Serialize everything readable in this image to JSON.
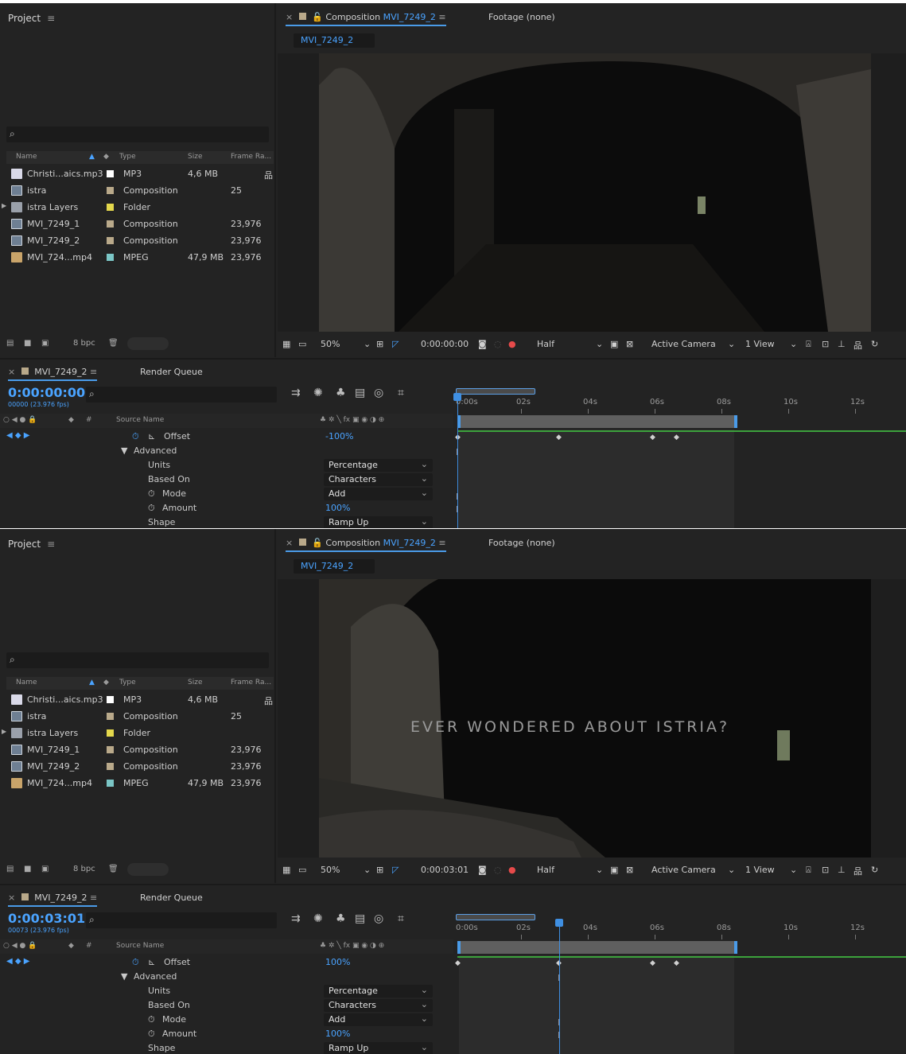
{
  "screens": [
    {
      "project": {
        "title": "Project",
        "menu_icon": "≡",
        "search_icon": "⌕",
        "columns": {
          "name": "Name",
          "type": "Type",
          "size": "Size",
          "frame_rate": "Frame Ra..."
        },
        "items": [
          {
            "name": "Christi...aics.mp3",
            "type": "MP3",
            "size": "4,6 MB",
            "frame_rate": "",
            "icon": "audio-file-icon",
            "color": "#ffffff"
          },
          {
            "name": "istra",
            "type": "Composition",
            "size": "",
            "frame_rate": "25",
            "icon": "composition-icon",
            "color": "#b9a98a"
          },
          {
            "name": "istra Layers",
            "type": "Folder",
            "size": "",
            "frame_rate": "",
            "icon": "folder-icon",
            "color": "#e4d84c"
          },
          {
            "name": "MVI_7249_1",
            "type": "Composition",
            "size": "",
            "frame_rate": "23,976",
            "icon": "composition-icon",
            "color": "#b9a98a"
          },
          {
            "name": "MVI_7249_2",
            "type": "Composition",
            "size": "",
            "frame_rate": "23,976",
            "icon": "composition-icon",
            "color": "#b9a98a"
          },
          {
            "name": "MVI_724...mp4",
            "type": "MPEG",
            "size": "47,9 MB",
            "frame_rate": "23,976",
            "icon": "video-file-icon",
            "color": "#7bc6c6"
          }
        ],
        "bit_depth": "8 bpc"
      },
      "composition": {
        "tab_prefix": "Composition",
        "tab_name": "MVI_7249_2",
        "footage_tab": "Footage (none)",
        "subtab": "MVI_7249_2",
        "overlay_text": "",
        "toolbar": {
          "zoom": "50%",
          "timecode": "0:00:00:00",
          "resolution": "Half",
          "camera": "Active Camera",
          "views": "1 View"
        }
      },
      "timeline": {
        "tab": "MVI_7249_2",
        "render_queue": "Render Queue",
        "timecode": "0:00:00:00",
        "frame_info": "00000 (23.976 fps)",
        "source_name_header": "Source Name",
        "ruler": [
          "0:00s",
          "02s",
          "04s",
          "06s",
          "08s",
          "10s",
          "12s"
        ],
        "current_time_seconds": 0.0,
        "properties": {
          "offset_label": "Offset",
          "offset_value": "-100%",
          "advanced_label": "Advanced",
          "units_label": "Units",
          "units_value": "Percentage",
          "based_on_label": "Based On",
          "based_on_value": "Characters",
          "mode_label": "Mode",
          "mode_value": "Add",
          "amount_label": "Amount",
          "amount_value": "100%",
          "shape_label": "Shape",
          "shape_value": "Ramp Up"
        }
      }
    },
    {
      "project": {
        "title": "Project",
        "menu_icon": "≡",
        "search_icon": "⌕",
        "columns": {
          "name": "Name",
          "type": "Type",
          "size": "Size",
          "frame_rate": "Frame Ra..."
        },
        "items": [
          {
            "name": "Christi...aics.mp3",
            "type": "MP3",
            "size": "4,6 MB",
            "frame_rate": "",
            "icon": "audio-file-icon",
            "color": "#ffffff"
          },
          {
            "name": "istra",
            "type": "Composition",
            "size": "",
            "frame_rate": "25",
            "icon": "composition-icon",
            "color": "#b9a98a"
          },
          {
            "name": "istra Layers",
            "type": "Folder",
            "size": "",
            "frame_rate": "",
            "icon": "folder-icon",
            "color": "#e4d84c"
          },
          {
            "name": "MVI_7249_1",
            "type": "Composition",
            "size": "",
            "frame_rate": "23,976",
            "icon": "composition-icon",
            "color": "#b9a98a"
          },
          {
            "name": "MVI_7249_2",
            "type": "Composition",
            "size": "",
            "frame_rate": "23,976",
            "icon": "composition-icon",
            "color": "#b9a98a"
          },
          {
            "name": "MVI_724...mp4",
            "type": "MPEG",
            "size": "47,9 MB",
            "frame_rate": "23,976",
            "icon": "video-file-icon",
            "color": "#7bc6c6"
          }
        ],
        "bit_depth": "8 bpc"
      },
      "composition": {
        "tab_prefix": "Composition",
        "tab_name": "MVI_7249_2",
        "footage_tab": "Footage (none)",
        "subtab": "MVI_7249_2",
        "overlay_text": "EVER WONDERED ABOUT ISTRIA?",
        "toolbar": {
          "zoom": "50%",
          "timecode": "0:00:03:01",
          "resolution": "Half",
          "camera": "Active Camera",
          "views": "1 View"
        }
      },
      "timeline": {
        "tab": "MVI_7249_2",
        "render_queue": "Render Queue",
        "timecode": "0:00:03:01",
        "frame_info": "00073 (23.976 fps)",
        "source_name_header": "Source Name",
        "ruler": [
          "0:00s",
          "02s",
          "04s",
          "06s",
          "08s",
          "10s",
          "12s"
        ],
        "current_time_seconds": 3.04,
        "properties": {
          "offset_label": "Offset",
          "offset_value": "100%",
          "advanced_label": "Advanced",
          "units_label": "Units",
          "units_value": "Percentage",
          "based_on_label": "Based On",
          "based_on_value": "Characters",
          "mode_label": "Mode",
          "mode_value": "Add",
          "amount_label": "Amount",
          "amount_value": "100%",
          "shape_label": "Shape",
          "shape_value": "Ramp Up"
        }
      }
    }
  ],
  "colors": {
    "accent": "#4aa3ff",
    "panel": "#232323",
    "work_area": "#5f5f5f",
    "audio_line": "#3ca23c"
  }
}
